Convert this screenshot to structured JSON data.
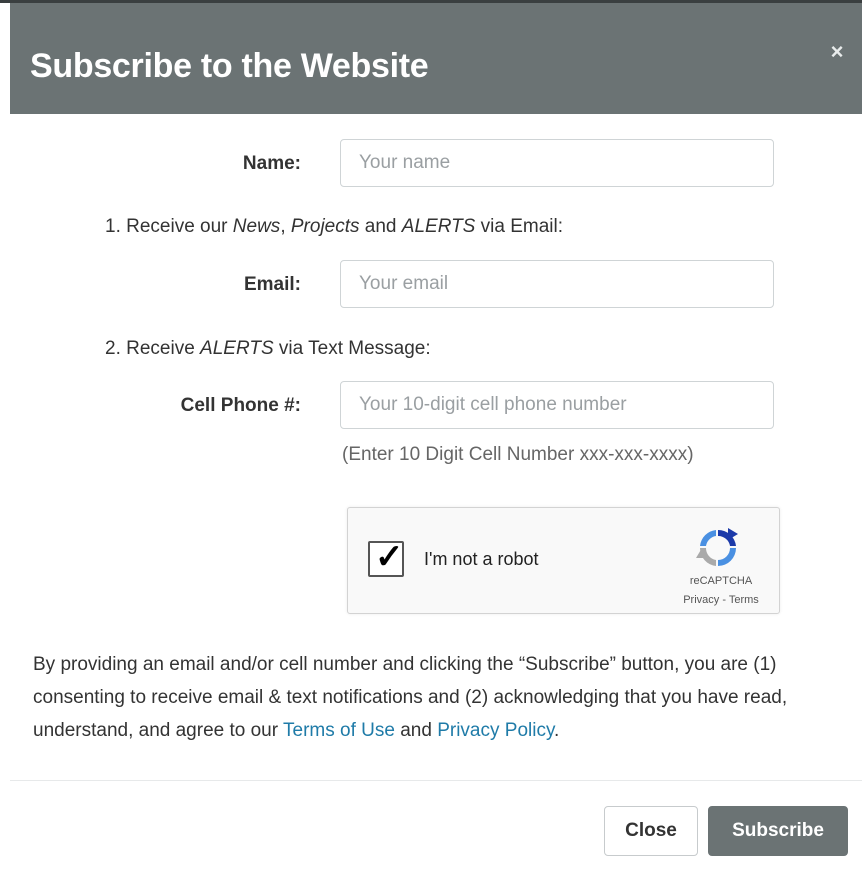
{
  "dialog": {
    "title": "Subscribe to the Website",
    "close_symbol": "×"
  },
  "form": {
    "name": {
      "label": "Name:",
      "placeholder": "Your name",
      "value": ""
    },
    "email_intro": {
      "prefix": "1. Receive our ",
      "news": "News",
      "sep": ", ",
      "projects": "Projects",
      "and": " and ",
      "alerts": "ALERTS",
      "suffix": " via Email:"
    },
    "email": {
      "label": "Email:",
      "placeholder": "Your email",
      "value": ""
    },
    "text_intro": {
      "prefix": "2. Receive ",
      "alerts": "ALERTS",
      "suffix": " via Text Message:"
    },
    "phone": {
      "label": "Cell Phone #:",
      "placeholder": "Your 10-digit cell phone number",
      "value": "",
      "hint": "(Enter 10 Digit Cell Number xxx-xxx-xxxx)"
    }
  },
  "recaptcha": {
    "label": "I'm not a robot",
    "checked": true,
    "check_mark": "✓",
    "brand": "reCAPTCHA",
    "privacy": "Privacy",
    "sep": " - ",
    "terms": "Terms"
  },
  "disclaimer": {
    "text_before": "By providing an email and/or cell number and clicking the “Subscribe” button, you are (1) consenting to receive email & text notifications and (2) acknowledging that you have read, understand, and agree to our ",
    "terms_link": "Terms of Use",
    "middle": " and ",
    "privacy_link": "Privacy Policy",
    "end": "."
  },
  "footer": {
    "close_label": "Close",
    "subscribe_label": "Subscribe"
  },
  "colors": {
    "header_bg": "#6b7374",
    "link": "#1f7ba8",
    "subscribe_bg": "#6b7374"
  }
}
